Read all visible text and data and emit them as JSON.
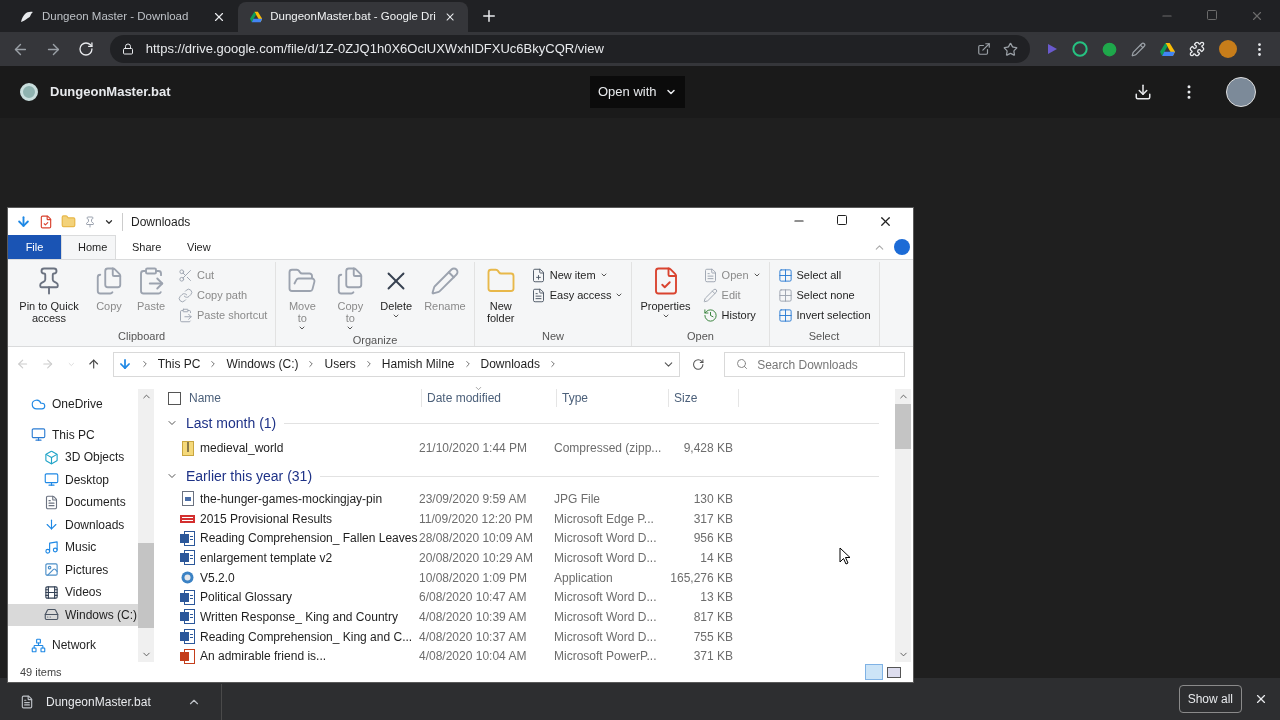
{
  "browser": {
    "tabs": [
      {
        "title": "Dungeon Master - Download",
        "selected": false,
        "kind": "dragon"
      },
      {
        "title": "DungeonMaster.bat - Google Dri",
        "selected": true,
        "kind": "drive"
      }
    ],
    "url": "https://drive.google.com/file/d/1Z-0ZJQ1h0X6OclUXWxhIDFXUc6BkyCQR/view"
  },
  "drive": {
    "file_name": "DungeonMaster.bat",
    "open_with": "Open with"
  },
  "explorer": {
    "title": "Downloads",
    "ribbon_tabs": [
      {
        "label": "File",
        "selected": false,
        "kind": "file"
      },
      {
        "label": "Home",
        "selected": true,
        "kind": "tab"
      },
      {
        "label": "Share",
        "selected": false,
        "kind": "tab"
      },
      {
        "label": "View",
        "selected": false,
        "kind": "tab"
      }
    ],
    "groups": [
      {
        "label": "Clipboard",
        "commands": [
          {
            "label": "Pin to Quick access",
            "kind": "large",
            "disabled": false,
            "dropdown": false
          },
          {
            "label": "Copy",
            "kind": "large",
            "disabled": true,
            "dropdown": false
          },
          {
            "label": "Paste",
            "kind": "large",
            "disabled": true,
            "dropdown": false
          },
          {
            "label": "Cut",
            "kind": "small",
            "disabled": true,
            "dropdown": false
          },
          {
            "label": "Copy path",
            "kind": "small",
            "disabled": true,
            "dropdown": false
          },
          {
            "label": "Paste shortcut",
            "kind": "small",
            "disabled": true,
            "dropdown": false
          }
        ]
      },
      {
        "label": "Organize",
        "commands": [
          {
            "label": "Move to",
            "kind": "large",
            "disabled": true,
            "dropdown": true
          },
          {
            "label": "Copy to",
            "kind": "large",
            "disabled": true,
            "dropdown": true
          },
          {
            "label": "Delete",
            "kind": "large",
            "disabled": false,
            "dropdown": true
          },
          {
            "label": "Rename",
            "kind": "large",
            "disabled": true,
            "dropdown": false
          }
        ]
      },
      {
        "label": "New",
        "commands": [
          {
            "label": "New folder",
            "kind": "large",
            "disabled": false,
            "dropdown": false
          },
          {
            "label": "New item",
            "kind": "small",
            "disabled": false,
            "dropdown": true
          },
          {
            "label": "Easy access",
            "kind": "small",
            "disabled": false,
            "dropdown": true
          }
        ]
      },
      {
        "label": "Open",
        "commands": [
          {
            "label": "Properties",
            "kind": "large",
            "disabled": false,
            "dropdown": true
          },
          {
            "label": "Open",
            "kind": "small",
            "disabled": true,
            "dropdown": true
          },
          {
            "label": "Edit",
            "kind": "small",
            "disabled": true,
            "dropdown": false
          },
          {
            "label": "History",
            "kind": "small",
            "disabled": false,
            "dropdown": false
          }
        ]
      },
      {
        "label": "Select",
        "commands": [
          {
            "label": "Select all",
            "kind": "small",
            "disabled": false,
            "dropdown": false
          },
          {
            "label": "Select none",
            "kind": "small",
            "disabled": false,
            "dropdown": false
          },
          {
            "label": "Invert selection",
            "kind": "small",
            "disabled": false,
            "dropdown": false
          }
        ]
      }
    ],
    "breadcrumb": [
      "This PC",
      "Windows (C:)",
      "Users",
      "Hamish Milne",
      "Downloads"
    ],
    "search": {
      "placeholder": "Search Downloads"
    },
    "nav": [
      {
        "label": "OneDrive",
        "kind": "cloud",
        "selected": false
      },
      {
        "label": "This PC",
        "kind": "pc",
        "selected": false,
        "children": [
          {
            "label": "3D Objects",
            "kind": "cube",
            "selected": false
          },
          {
            "label": "Desktop",
            "kind": "desktop",
            "selected": false
          },
          {
            "label": "Documents",
            "kind": "document",
            "selected": false
          },
          {
            "label": "Downloads",
            "kind": "download",
            "selected": false
          },
          {
            "label": "Music",
            "kind": "music",
            "selected": false
          },
          {
            "label": "Pictures",
            "kind": "pictures",
            "selected": false
          },
          {
            "label": "Videos",
            "kind": "video",
            "selected": false
          },
          {
            "label": "Windows (C:)",
            "kind": "drive",
            "selected": true
          }
        ]
      },
      {
        "label": "Network",
        "kind": "network",
        "selected": false
      }
    ],
    "select_all": {
      "checked": false
    },
    "columns": [
      "Name",
      "Date modified",
      "Type",
      "Size"
    ],
    "file_groups": [
      {
        "label": "Last month (1)",
        "expanded": true,
        "files": [
          {
            "name": "medieval_world",
            "date": "21/10/2020 1:44 PM",
            "type": "Compressed (zipp...",
            "size": "9,428 KB",
            "kind": "zip"
          }
        ]
      },
      {
        "label": "Earlier this year (31)",
        "expanded": true,
        "files": [
          {
            "name": "the-hunger-games-mockingjay-pin",
            "date": "23/09/2020 9:59 AM",
            "type": "JPG File",
            "size": "130 KB",
            "kind": "image"
          },
          {
            "name": "2015 Provisional Results",
            "date": "11/09/2020 12:20 PM",
            "type": "Microsoft Edge P...",
            "size": "317 KB",
            "kind": "pdf"
          },
          {
            "name": "Reading Comprehension_ Fallen Leaves",
            "date": "28/08/2020 10:09 AM",
            "type": "Microsoft Word D...",
            "size": "956 KB",
            "kind": "word"
          },
          {
            "name": "enlargement template v2",
            "date": "20/08/2020 10:29 AM",
            "type": "Microsoft Word D...",
            "size": "14 KB",
            "kind": "word"
          },
          {
            "name": "V5.2.0",
            "date": "10/08/2020 1:09 PM",
            "type": "Application",
            "size": "165,276 KB",
            "kind": "app"
          },
          {
            "name": "Political Glossary",
            "date": "6/08/2020 10:47 AM",
            "type": "Microsoft Word D...",
            "size": "13 KB",
            "kind": "word"
          },
          {
            "name": "Written Response_ King and Country",
            "date": "4/08/2020 10:39 AM",
            "type": "Microsoft Word D...",
            "size": "817 KB",
            "kind": "word"
          },
          {
            "name": "Reading Comprehension_ King and C...",
            "date": "4/08/2020 10:37 AM",
            "type": "Microsoft Word D...",
            "size": "755 KB",
            "kind": "word"
          },
          {
            "name": "An admirable friend is...",
            "date": "4/08/2020 10:04 AM",
            "type": "Microsoft PowerP...",
            "size": "371 KB",
            "kind": "ppt"
          }
        ]
      }
    ],
    "status": "49 items"
  },
  "download_shelf": {
    "file": "DungeonMaster.bat",
    "show_all": "Show all"
  }
}
